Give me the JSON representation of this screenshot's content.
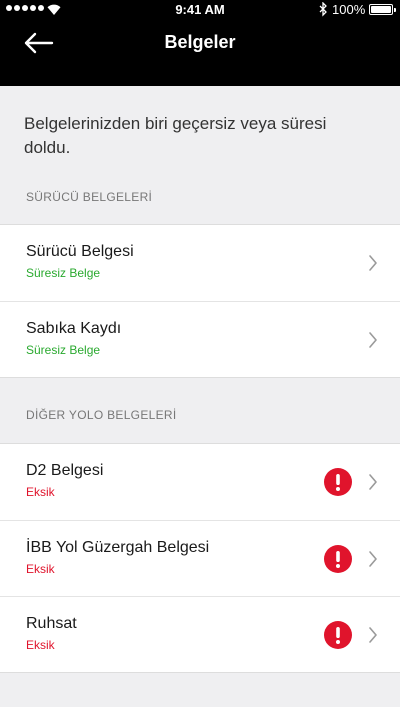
{
  "status_bar": {
    "time": "9:41 AM",
    "battery": "100%"
  },
  "nav": {
    "title": "Belgeler"
  },
  "notice": "Belgelerinizden biri geçersiz veya süresi doldu.",
  "sections": [
    {
      "header": "SÜRÜCÜ BELGELERİ",
      "items": [
        {
          "title": "Sürücü Belgesi",
          "status": "Süresiz Belge",
          "state": "valid"
        },
        {
          "title": "Sabıka Kaydı",
          "status": "Süresiz Belge",
          "state": "valid"
        }
      ]
    },
    {
      "header": "DİĞER YOLO BELGELERİ",
      "items": [
        {
          "title": "D2 Belgesi",
          "status": "Eksik",
          "state": "missing"
        },
        {
          "title": "İBB Yol Güzergah Belgesi",
          "status": "Eksik",
          "state": "missing"
        },
        {
          "title": "Ruhsat",
          "status": "Eksik",
          "state": "missing"
        }
      ]
    }
  ],
  "colors": {
    "valid": "#2aa92f",
    "missing": "#e0142c",
    "header_bg": "#000000"
  },
  "icons": [
    "back-arrow-icon",
    "chevron-right-icon",
    "alert-icon",
    "wifi-icon",
    "bluetooth-icon",
    "battery-icon"
  ]
}
